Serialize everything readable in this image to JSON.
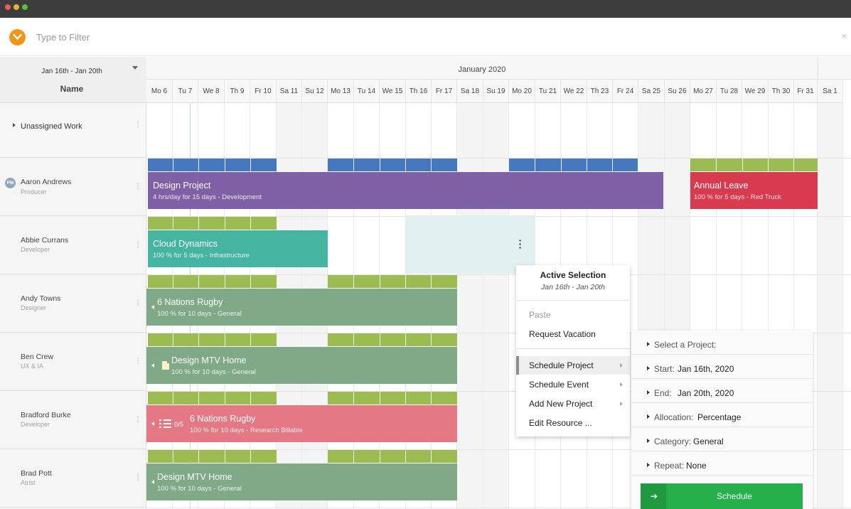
{
  "window": {
    "controls": [
      "close",
      "minimize",
      "maximize"
    ]
  },
  "filter": {
    "placeholder": "Type to Filter",
    "close_glyph": "×"
  },
  "sidebar": {
    "range_label": "Jan 16th - Jan 20th",
    "name_header": "Name",
    "unassigned_label": "Unassigned Work",
    "people": [
      {
        "name": "Aaron Andrews",
        "role": "Producer",
        "avatar": "PM"
      },
      {
        "name": "Abbie Currans",
        "role": "Developer"
      },
      {
        "name": "Andy Towns",
        "role": "Designer"
      },
      {
        "name": "Ben Crew",
        "role": "UX & IA"
      },
      {
        "name": "Bradford Burke",
        "role": "Developer"
      },
      {
        "name": "Brad Pott",
        "role": "Atrist"
      }
    ]
  },
  "calendar": {
    "month": "January 2020",
    "days": [
      "Mo 6",
      "Tu 7",
      "We 8",
      "Th 9",
      "Fr 10",
      "Sa 11",
      "Su 12",
      "Mo 13",
      "Tu 14",
      "We 15",
      "Th 16",
      "Fr 17",
      "Sa 18",
      "Su 19",
      "Mo 20",
      "Tu 21",
      "We 22",
      "Th 23",
      "Fr 24",
      "Sa 25",
      "Su 26",
      "Mo 27",
      "Tu 28",
      "We 29",
      "Th 30",
      "Fr 31",
      "Sa 1"
    ]
  },
  "bookings": {
    "design_project": {
      "title": "Design Project",
      "sub": "4 hrs/day for 15 days - Development"
    },
    "annual_leave": {
      "title": "Annual Leave",
      "sub": "100 % for 5 days - Red Truck"
    },
    "cloud_dynamics": {
      "title": "Cloud Dynamics",
      "sub": "100 % for 5 days - Infrastructure"
    },
    "six_nations_a": {
      "title": "6 Nations Rugby",
      "sub": "100 % for 10 days - General"
    },
    "design_mtv_a": {
      "title": "Design MTV Home",
      "sub": "100 % for 10 days - General"
    },
    "six_nations_b": {
      "title": "6 Nations Rugby",
      "sub": "100 % for 10 days - Research Billable",
      "task_count": "0/5"
    },
    "design_mtv_b": {
      "title": "Design MTV Home",
      "sub": "100 % for 10 days - General"
    }
  },
  "colors": {
    "purple": "#7f5fa5",
    "red": "#d83b4f",
    "teal": "#45b4a0",
    "sage": "#7fa987",
    "pink": "#e47884",
    "blue_strip": "#4578bf",
    "green_strip": "#9cbb50",
    "accent_orange": "#f29418",
    "schedule_green": "#26b04b"
  },
  "context_menu": {
    "title": "Active Selection",
    "subtitle": "Jan 16th - Jan 20th",
    "items": [
      "Paste",
      "Request Vacation",
      "Schedule Project",
      "Schedule Event",
      "Add New Project",
      "Edit Resource ..."
    ]
  },
  "schedule_panel": {
    "project_label": "Select a Project:",
    "start_label": "Start:",
    "start_value": "Jan 16th, 2020",
    "end_label": "End:",
    "end_value": "Jan 20th, 2020",
    "allocation_label": "Allocation:",
    "allocation_value": "Percentage",
    "category_label": "Category:",
    "category_value": "General",
    "repeat_label": "Repeat:",
    "repeat_value": "None",
    "button_label": "Schedule"
  }
}
